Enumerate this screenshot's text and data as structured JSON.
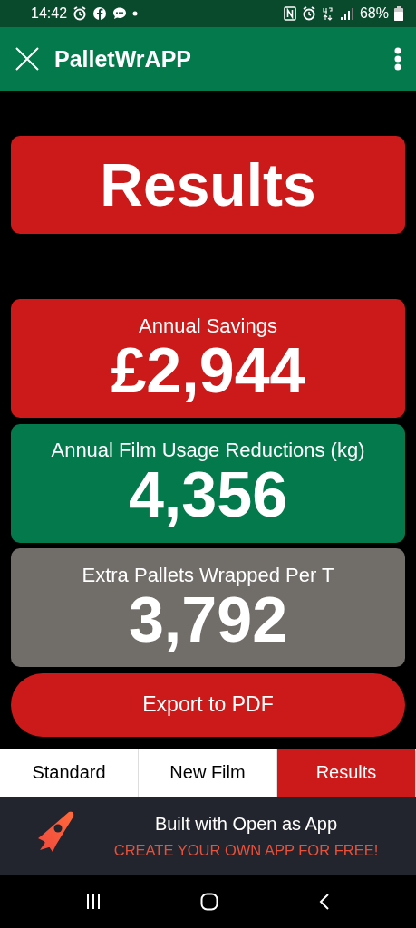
{
  "status_bar": {
    "time": "14:42",
    "battery": "68%"
  },
  "app_bar": {
    "title": "PalletWrAPP"
  },
  "header": {
    "title": "Results"
  },
  "stats": [
    {
      "label": "Annual Savings",
      "value": "£2,944",
      "color": "#cc1a1a"
    },
    {
      "label": "Annual Film Usage Reductions (kg)",
      "value": "4,356",
      "color": "#047a4c"
    },
    {
      "label": "Extra Pallets Wrapped Per T",
      "value": "3,792",
      "color": "#716d69"
    }
  ],
  "export_button": {
    "label": "Export to PDF"
  },
  "tabs": [
    {
      "label": "Standard",
      "selected": false
    },
    {
      "label": "New Film",
      "selected": false
    },
    {
      "label": "Results",
      "selected": true
    }
  ],
  "banner": {
    "title": "Built with Open as App",
    "link": "CREATE YOUR OWN APP FOR FREE!"
  }
}
